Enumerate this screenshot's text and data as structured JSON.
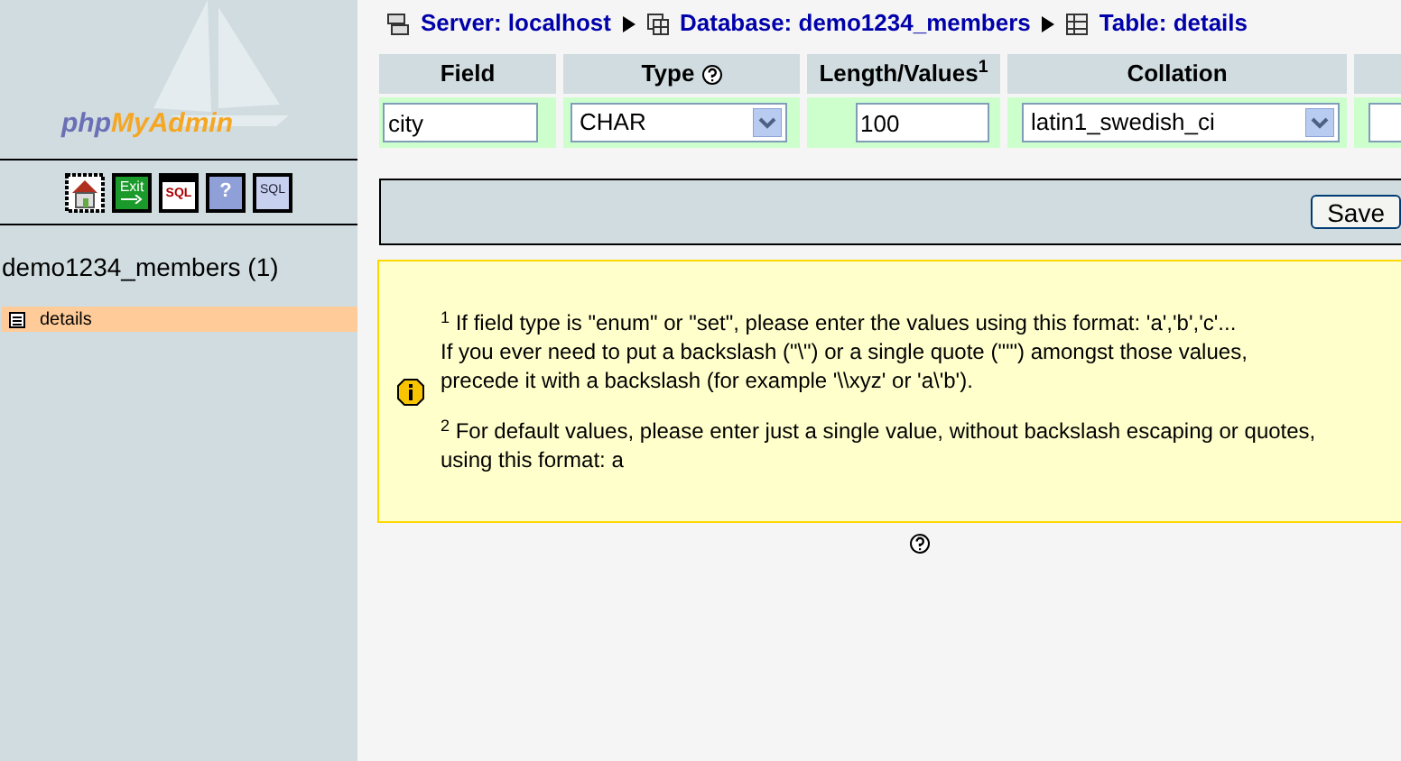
{
  "sidebar": {
    "logo": {
      "first": "php",
      "second": "MyAdmin"
    },
    "icons": [
      {
        "kind": "home"
      },
      {
        "kind": "exit",
        "label": "Exit"
      },
      {
        "kind": "sql",
        "label": "SQL"
      },
      {
        "kind": "help",
        "label": "?"
      },
      {
        "kind": "query",
        "label": "SQL"
      }
    ],
    "database": "demo1234_members (1)",
    "tables": [
      {
        "label": "details",
        "selected": true
      }
    ]
  },
  "breadcrumb": [
    {
      "kind": "server",
      "label": "Server: localhost"
    },
    {
      "kind": "database",
      "label": "Database: demo1234_members"
    },
    {
      "kind": "table",
      "label": "Table: details"
    }
  ],
  "table": {
    "columns": [
      {
        "label": "Field"
      },
      {
        "label": "Type",
        "help": true
      },
      {
        "label": "Length/Values$^{1}$"
      },
      {
        "label": "Collation"
      }
    ],
    "row": {
      "field": "city",
      "type": "CHAR",
      "length": "100",
      "collation": "latin1_swedish_ci"
    }
  },
  "save_button": "Save",
  "note": {
    "paragraphs": [
      [
        "$^{1}$ If field type is \"enum\" or \"set\", please enter the values using this format: 'a','b','c'...",
        "If you ever need to put a backslash (\"\\\") or a single quote (\"'\") amongst those values,",
        "precede it with a backslash (for example '\\\\xyz' or 'a\\'b')."
      ],
      [
        "$^{2}$ For default values, please enter just a single value, without backslash escaping or quotes,",
        "using this format: a"
      ]
    ]
  }
}
